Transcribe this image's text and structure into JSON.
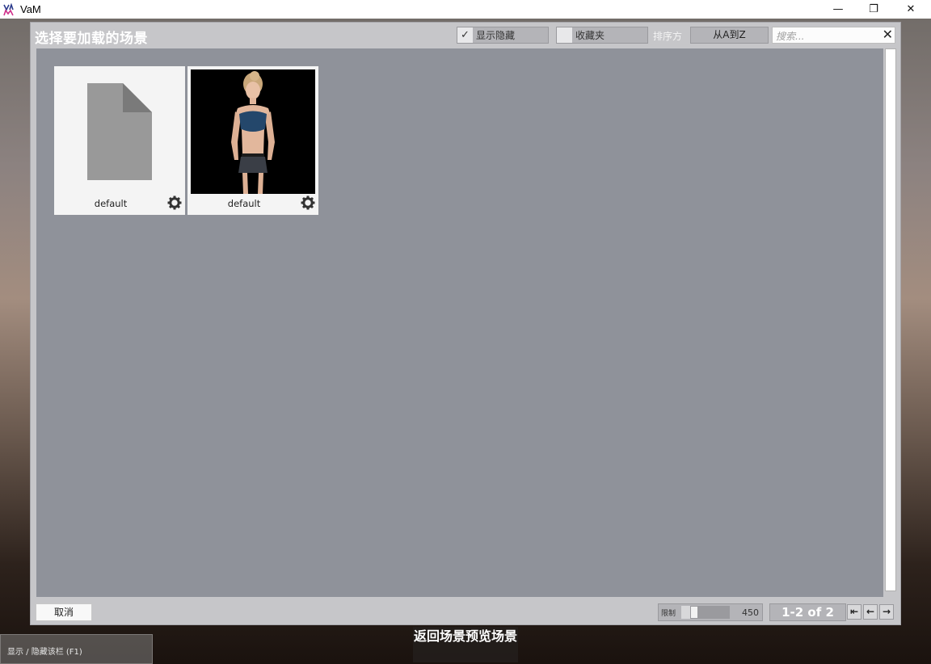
{
  "window": {
    "title": "VaM",
    "minimize_glyph": "—",
    "restore_glyph": "❐",
    "close_glyph": "✕"
  },
  "dialog": {
    "title": "选择要加载的场景",
    "show_hidden": {
      "label": "显示隐藏",
      "checked": true
    },
    "favorites": {
      "label": "收藏夹",
      "checked": false
    },
    "sort_label": "排序方",
    "sort_value": "从A到Z",
    "search": {
      "placeholder": "搜索...",
      "value": "",
      "clear_glyph": "✕"
    }
  },
  "items": [
    {
      "name": "default",
      "thumbnail": "file-icon"
    },
    {
      "name": "default",
      "thumbnail": "character-photo"
    }
  ],
  "footer": {
    "cancel_label": "取消",
    "limit_label": "限制",
    "limit_value": "450",
    "limit_slider_fraction": 0.22,
    "page_info": "1-2 of 2",
    "first_glyph": "⇤",
    "prev_glyph": "←",
    "next_glyph": "→"
  },
  "overlay": {
    "toggle_bar_label": "显示 / 隐藏该栏 (F1)",
    "return_button_label": "返回场景预览场景"
  },
  "colors": {
    "dialog_bg": "#c6c6c9",
    "content_bg": "#8f929a",
    "card_bg": "#f4f4f4"
  }
}
